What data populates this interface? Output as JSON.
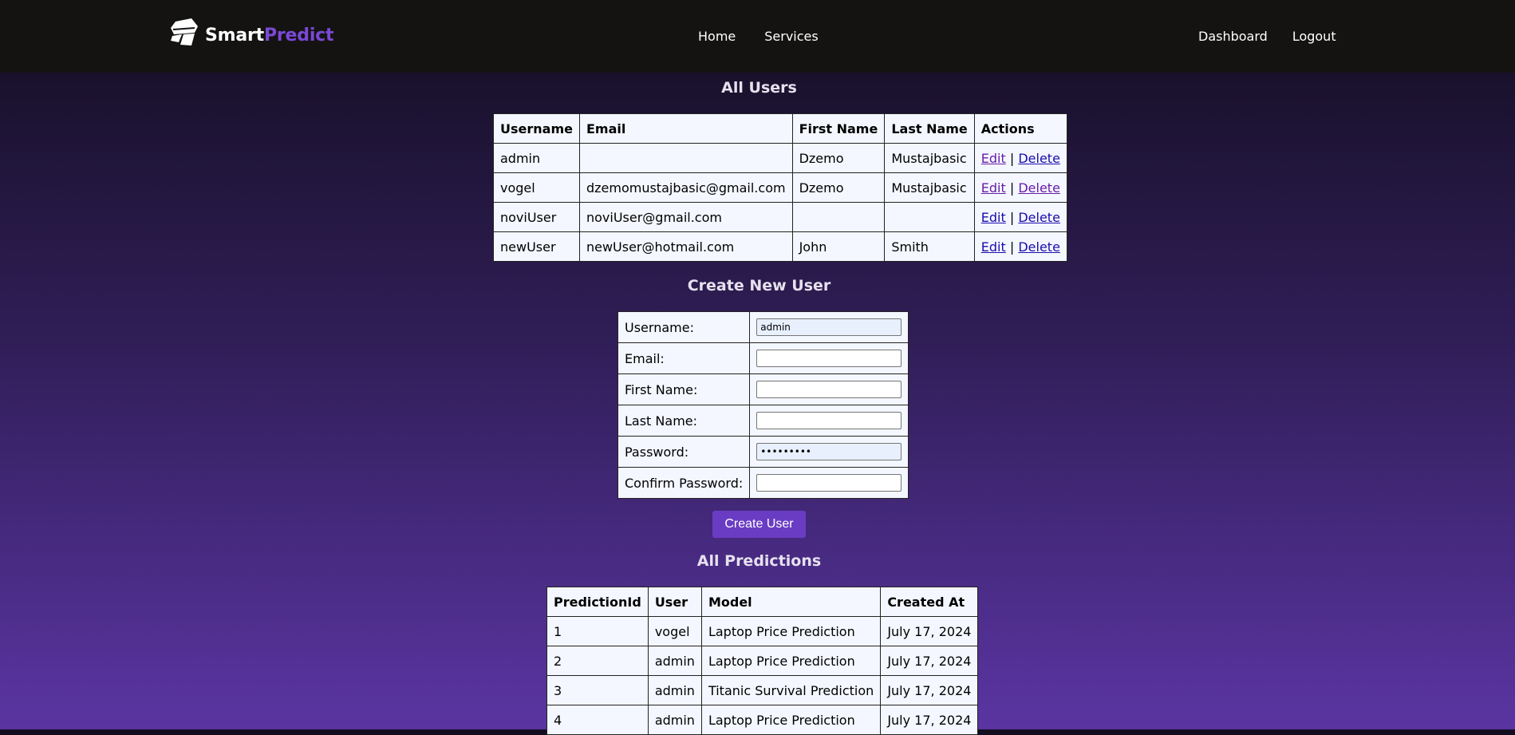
{
  "brand": {
    "name_part1": "Smart",
    "name_part2": "Predict"
  },
  "nav": {
    "center": [
      "Home",
      "Services"
    ],
    "right": [
      "Dashboard",
      "Logout"
    ]
  },
  "users": {
    "title": "All Users",
    "columns": [
      "Username",
      "Email",
      "First Name",
      "Last Name",
      "Actions"
    ],
    "rows": [
      {
        "username": "admin",
        "email": "",
        "first_name": "Dzemo",
        "last_name": "Mustajbasic"
      },
      {
        "username": "vogel",
        "email": "dzemomustajbasic@gmail.com",
        "first_name": "Dzemo",
        "last_name": "Mustajbasic"
      },
      {
        "username": "noviUser",
        "email": "noviUser@gmail.com",
        "first_name": "",
        "last_name": ""
      },
      {
        "username": "newUser",
        "email": "newUser@hotmail.com",
        "first_name": "John",
        "last_name": "Smith"
      }
    ],
    "edit_label": "Edit",
    "separator": "|",
    "delete_label": "Delete"
  },
  "create_user": {
    "title": "Create New User",
    "fields": [
      {
        "label": "Username:",
        "value": "admin"
      },
      {
        "label": "Email:",
        "value": ""
      },
      {
        "label": "First Name:",
        "value": ""
      },
      {
        "label": "Last Name:",
        "value": ""
      },
      {
        "label": "Password:",
        "value": "•••••••••"
      },
      {
        "label": "Confirm Password:",
        "value": ""
      }
    ],
    "submit_label": "Create User"
  },
  "predictions": {
    "title": "All Predictions",
    "columns": [
      "PredictionId",
      "User",
      "Model",
      "Created At"
    ],
    "rows": [
      {
        "id": "1",
        "user": "vogel",
        "model": "Laptop Price Prediction",
        "created_at": "July 17, 2024"
      },
      {
        "id": "2",
        "user": "admin",
        "model": "Laptop Price Prediction",
        "created_at": "July 17, 2024"
      },
      {
        "id": "3",
        "user": "admin",
        "model": "Titanic Survival Prediction",
        "created_at": "July 17, 2024"
      },
      {
        "id": "4",
        "user": "admin",
        "model": "Laptop Price Prediction",
        "created_at": "July 17, 2024"
      }
    ]
  },
  "colors": {
    "navbar_bg": "#141312",
    "brand_accent": "#7b48d6",
    "button_bg": "#6a3cc3",
    "table_bg": "#f4f7ff"
  }
}
